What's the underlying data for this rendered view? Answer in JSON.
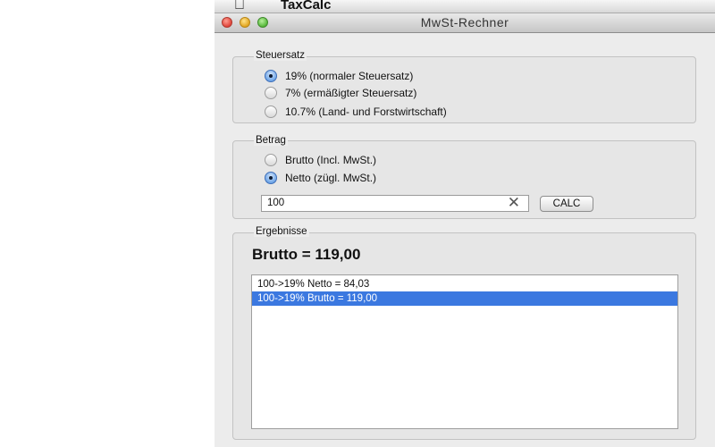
{
  "menubar": {
    "apple_icon": "apple-icon",
    "app_name": "TaxCalc"
  },
  "window": {
    "title": "MwSt-Rechner"
  },
  "steuersatz": {
    "legend": "Steuersatz",
    "options": [
      {
        "label": "19% (normaler Steuersatz)",
        "selected": true
      },
      {
        "label": "7% (ermäßigter Steuersatz)",
        "selected": false
      },
      {
        "label": "10.7% (Land- und Forstwirtschaft)",
        "selected": false
      }
    ]
  },
  "betrag": {
    "legend": "Betrag",
    "options": [
      {
        "label": "Brutto (Incl. MwSt.)",
        "selected": false
      },
      {
        "label": "Netto (zügl. MwSt.)",
        "selected": true
      }
    ],
    "amount_value": "100",
    "calc_label": "CALC",
    "clear_icon": "clear-x-icon"
  },
  "ergebnisse": {
    "legend": "Ergebnisse",
    "result": "Brutto = 119,00",
    "rows": [
      {
        "text": "100->19% Netto = 84,03",
        "selected": false
      },
      {
        "text": "100->19% Brutto = 119,00",
        "selected": true
      }
    ]
  }
}
